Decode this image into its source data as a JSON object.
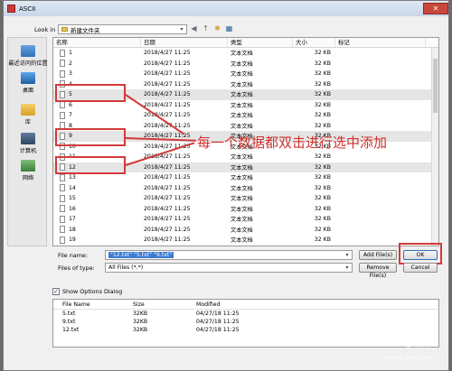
{
  "window": {
    "title": "ASCII",
    "close_glyph": "✕"
  },
  "lookin": {
    "label": "Look in",
    "value": "新建文件夹",
    "arrow": "▾"
  },
  "nav_icons": {
    "back": "◀",
    "up": "↑",
    "new_folder": "✱",
    "views": "▦"
  },
  "places": [
    {
      "label": "最近访问的位置",
      "icon": "recent-places-icon"
    },
    {
      "label": "桌面",
      "icon": "desktop-icon"
    },
    {
      "label": "库",
      "icon": "library-icon"
    },
    {
      "label": "计算机",
      "icon": "computer-icon"
    },
    {
      "label": "网络",
      "icon": "network-icon"
    }
  ],
  "columns": {
    "name": "名称",
    "date": "日期",
    "type": "类型",
    "size": "大小",
    "tag": "标记"
  },
  "files": [
    {
      "name": "1",
      "date": "2018/4/27 11:25",
      "type": "文本文档",
      "size": "32 KB"
    },
    {
      "name": "2",
      "date": "2018/4/27 11:25",
      "type": "文本文档",
      "size": "32 KB"
    },
    {
      "name": "3",
      "date": "2018/4/27 11:25",
      "type": "文本文档",
      "size": "32 KB"
    },
    {
      "name": "4",
      "date": "2018/4/27 11:25",
      "type": "文本文档",
      "size": "32 KB"
    },
    {
      "name": "5",
      "date": "2018/4/27 11:25",
      "type": "文本文档",
      "size": "32 KB"
    },
    {
      "name": "6",
      "date": "2018/4/27 11:25",
      "type": "文本文档",
      "size": "32 KB"
    },
    {
      "name": "7",
      "date": "2018/4/27 11:25",
      "type": "文本文档",
      "size": "32 KB"
    },
    {
      "name": "8",
      "date": "2018/4/27 11:25",
      "type": "文本文档",
      "size": "32 KB"
    },
    {
      "name": "9",
      "date": "2018/4/27 11:25",
      "type": "文本文档",
      "size": "32 KB"
    },
    {
      "name": "10",
      "date": "2018/4/27 11:25",
      "type": "文本文档",
      "size": "32 KB"
    },
    {
      "name": "11",
      "date": "2018/4/27 11:25",
      "type": "文本文档",
      "size": "32 KB"
    },
    {
      "name": "12",
      "date": "2018/4/27 11:25",
      "type": "文本文档",
      "size": "32 KB"
    },
    {
      "name": "13",
      "date": "2018/4/27 11:25",
      "type": "文本文档",
      "size": "32 KB"
    },
    {
      "name": "14",
      "date": "2018/4/27 11:25",
      "type": "文本文档",
      "size": "32 KB"
    },
    {
      "name": "15",
      "date": "2018/4/27 11:25",
      "type": "文本文档",
      "size": "32 KB"
    },
    {
      "name": "16",
      "date": "2018/4/27 11:25",
      "type": "文本文档",
      "size": "32 KB"
    },
    {
      "name": "17",
      "date": "2018/4/27 11:25",
      "type": "文本文档",
      "size": "32 KB"
    },
    {
      "name": "18",
      "date": "2018/4/27 11:25",
      "type": "文本文档",
      "size": "32 KB"
    },
    {
      "name": "19",
      "date": "2018/4/27 11:25",
      "type": "文本文档",
      "size": "32 KB"
    }
  ],
  "selected_files": [
    "5",
    "9",
    "12"
  ],
  "annotation": "每一个数据都双击进行选中添加",
  "filename": {
    "label": "File name:",
    "value": "\"12.txt\" \"5.txt\" \"9.txt\"",
    "arrow": "▾"
  },
  "filetype": {
    "label": "Files of type:",
    "value": "All Files (*.*)",
    "arrow": "▾"
  },
  "buttons": {
    "add": "Add File(s)",
    "ok": "OK",
    "remove": "Remove File(s)",
    "cancel": "Cancel"
  },
  "show_options": {
    "label": "Show Options Dialog",
    "checked": true,
    "check_glyph": "✓"
  },
  "options_table": {
    "headers": {
      "name": "File Name",
      "size": "Size",
      "modified": "Modified"
    },
    "rows": [
      {
        "name": "5.txt",
        "size": "32KB",
        "modified": "04/27/18 11:25"
      },
      {
        "name": "9.txt",
        "size": "32KB",
        "modified": "04/27/18 11:25"
      },
      {
        "name": "12.txt",
        "size": "32KB",
        "modified": "04/27/18 11:25"
      }
    ]
  },
  "watermark": {
    "main": "Baiⓓ经验",
    "sub": "jingyan.baidu.com"
  },
  "colors": {
    "highlight": "#d23a3a",
    "selection": "#3b7ad3"
  }
}
